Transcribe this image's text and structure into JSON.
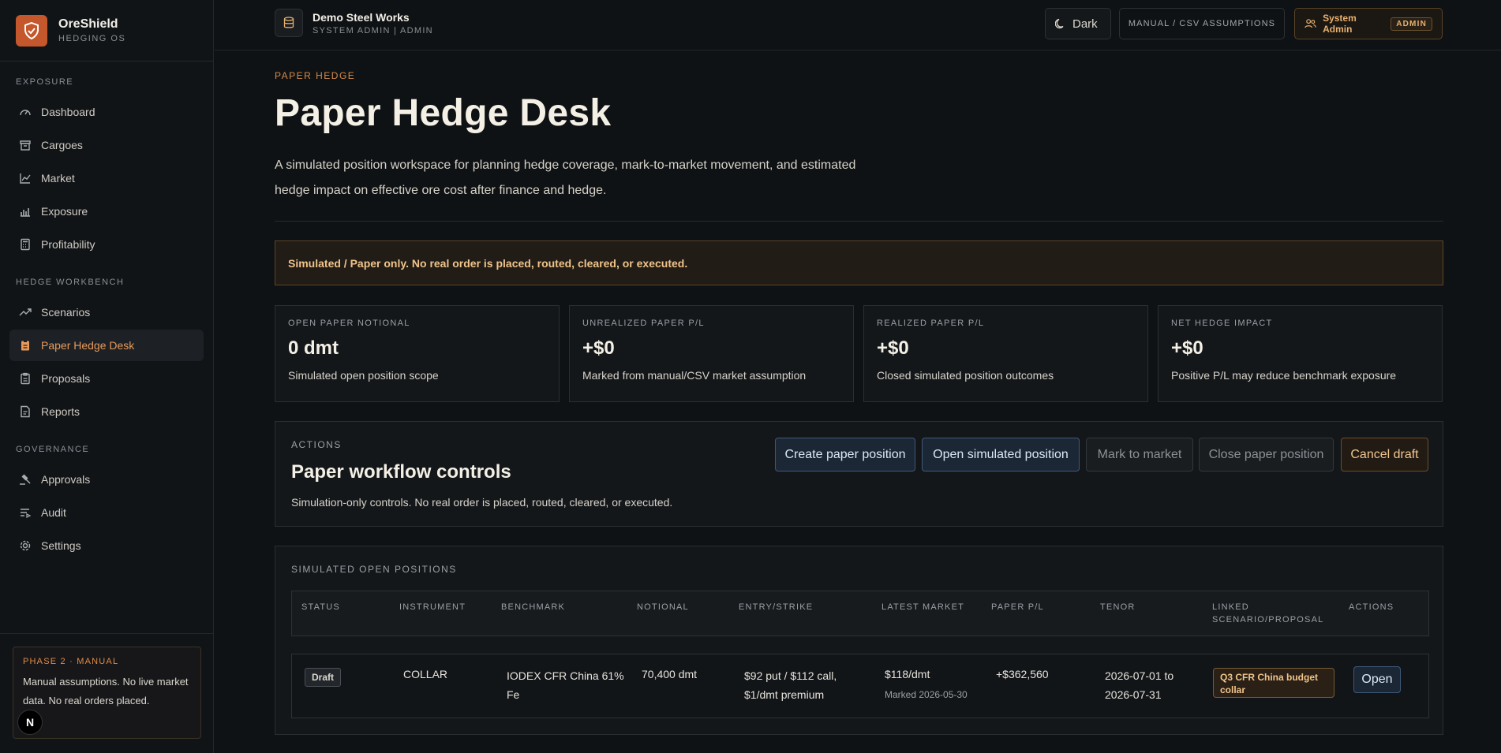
{
  "brand": {
    "name": "OreShield",
    "subtitle": "HEDGING OS"
  },
  "sidebar": {
    "sections": [
      {
        "title": "EXPOSURE",
        "items": [
          {
            "label": "Dashboard",
            "icon": "gauge-icon"
          },
          {
            "label": "Cargoes",
            "icon": "archive-icon"
          },
          {
            "label": "Market",
            "icon": "line-chart-icon"
          },
          {
            "label": "Exposure",
            "icon": "factory-chart-icon"
          },
          {
            "label": "Profitability",
            "icon": "calculator-icon"
          }
        ]
      },
      {
        "title": "HEDGE WORKBENCH",
        "items": [
          {
            "label": "Scenarios",
            "icon": "trending-up-icon"
          },
          {
            "label": "Paper Hedge Desk",
            "icon": "clipboard-icon",
            "active": true
          },
          {
            "label": "Proposals",
            "icon": "clipboard-list-icon"
          },
          {
            "label": "Reports",
            "icon": "file-text-icon"
          }
        ]
      },
      {
        "title": "GOVERNANCE",
        "items": [
          {
            "label": "Approvals",
            "icon": "gavel-icon"
          },
          {
            "label": "Audit",
            "icon": "list-filter-icon"
          },
          {
            "label": "Settings",
            "icon": "gear-icon"
          }
        ]
      }
    ],
    "phase": {
      "title": "PHASE 2 · MANUAL",
      "text": "Manual assumptions. No live market data. No real orders placed."
    },
    "n_badge": "N"
  },
  "topbar": {
    "org_name": "Demo Steel Works",
    "org_sub": "SYSTEM ADMIN | ADMIN",
    "theme_label": "Dark",
    "assumptions_label": "MANUAL / CSV ASSUMPTIONS",
    "user_label": "System Admin",
    "user_role": "ADMIN"
  },
  "page": {
    "eyebrow": "PAPER HEDGE",
    "title": "Paper Hedge Desk",
    "description": "A simulated position workspace for planning hedge coverage, mark-to-market movement, and estimated hedge impact on effective ore cost after finance and hedge.",
    "banner": "Simulated / Paper only. No real order is placed, routed, cleared, or executed."
  },
  "kpis": [
    {
      "label": "OPEN PAPER NOTIONAL",
      "value": "0 dmt",
      "sub": "Simulated open position scope"
    },
    {
      "label": "UNREALIZED PAPER P/L",
      "value": "+$0",
      "sub": "Marked from manual/CSV market assumption"
    },
    {
      "label": "REALIZED PAPER P/L",
      "value": "+$0",
      "sub": "Closed simulated position outcomes"
    },
    {
      "label": "NET HEDGE IMPACT",
      "value": "+$0",
      "sub": "Positive P/L may reduce benchmark exposure"
    }
  ],
  "actions": {
    "eyebrow": "ACTIONS",
    "title": "Paper workflow controls",
    "subtitle": "Simulation-only controls. No real order is placed, routed, cleared, or executed.",
    "buttons": {
      "create": "Create paper position",
      "open": "Open simulated position",
      "mark": "Mark to market",
      "close": "Close paper position",
      "cancel": "Cancel draft"
    }
  },
  "positions": {
    "eyebrow": "SIMULATED OPEN POSITIONS",
    "columns": {
      "status": "STATUS",
      "instrument": "INSTRUMENT",
      "benchmark": "BENCHMARK",
      "notional": "NOTIONAL",
      "entry": "ENTRY/STRIKE",
      "latest": "LATEST MARKET",
      "pl": "PAPER P/L",
      "tenor": "TENOR",
      "linked": "LINKED SCENARIO/PROPOSAL",
      "actions": "ACTIONS"
    },
    "rows": [
      {
        "status": "Draft",
        "instrument": "COLLAR",
        "benchmark": "IODEX CFR China 61% Fe",
        "notional": "70,400 dmt",
        "entry": "$92 put / $112 call, $1/dmt premium",
        "latest": "$118/dmt",
        "latest_sub": "Marked 2026-05-30",
        "pl": "+$362,560",
        "tenor": "2026-07-01 to 2026-07-31",
        "linked": "Q3 CFR China budget collar",
        "action": "Open"
      }
    ]
  },
  "colors": {
    "accent": "#e79a5a",
    "brand": "#c4572c",
    "warning_bg": "#211c16",
    "primary_btn": "#1c2735"
  }
}
